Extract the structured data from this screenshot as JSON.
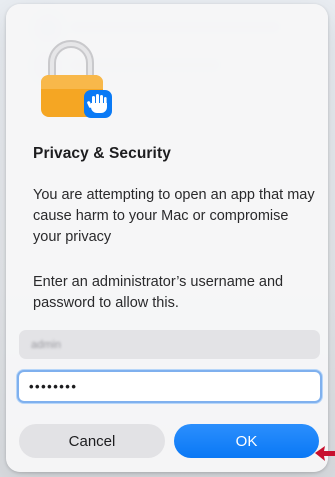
{
  "dialog": {
    "title": "Privacy & Security",
    "message": "You are attempting to open an app that may cause harm to your Mac or compromise your privacy",
    "instruction": "Enter an administrator’s username and password to allow this.",
    "username_value": "admin",
    "password_masked": "••••••••",
    "cancel_label": "Cancel",
    "ok_label": "OK"
  },
  "icons": {
    "lock": "lock-hand-icon",
    "arrow": "red-arrow-icon"
  },
  "colors": {
    "accent": "#0a7af5",
    "lock_body": "#f5a623",
    "arrow": "#c8102e"
  }
}
